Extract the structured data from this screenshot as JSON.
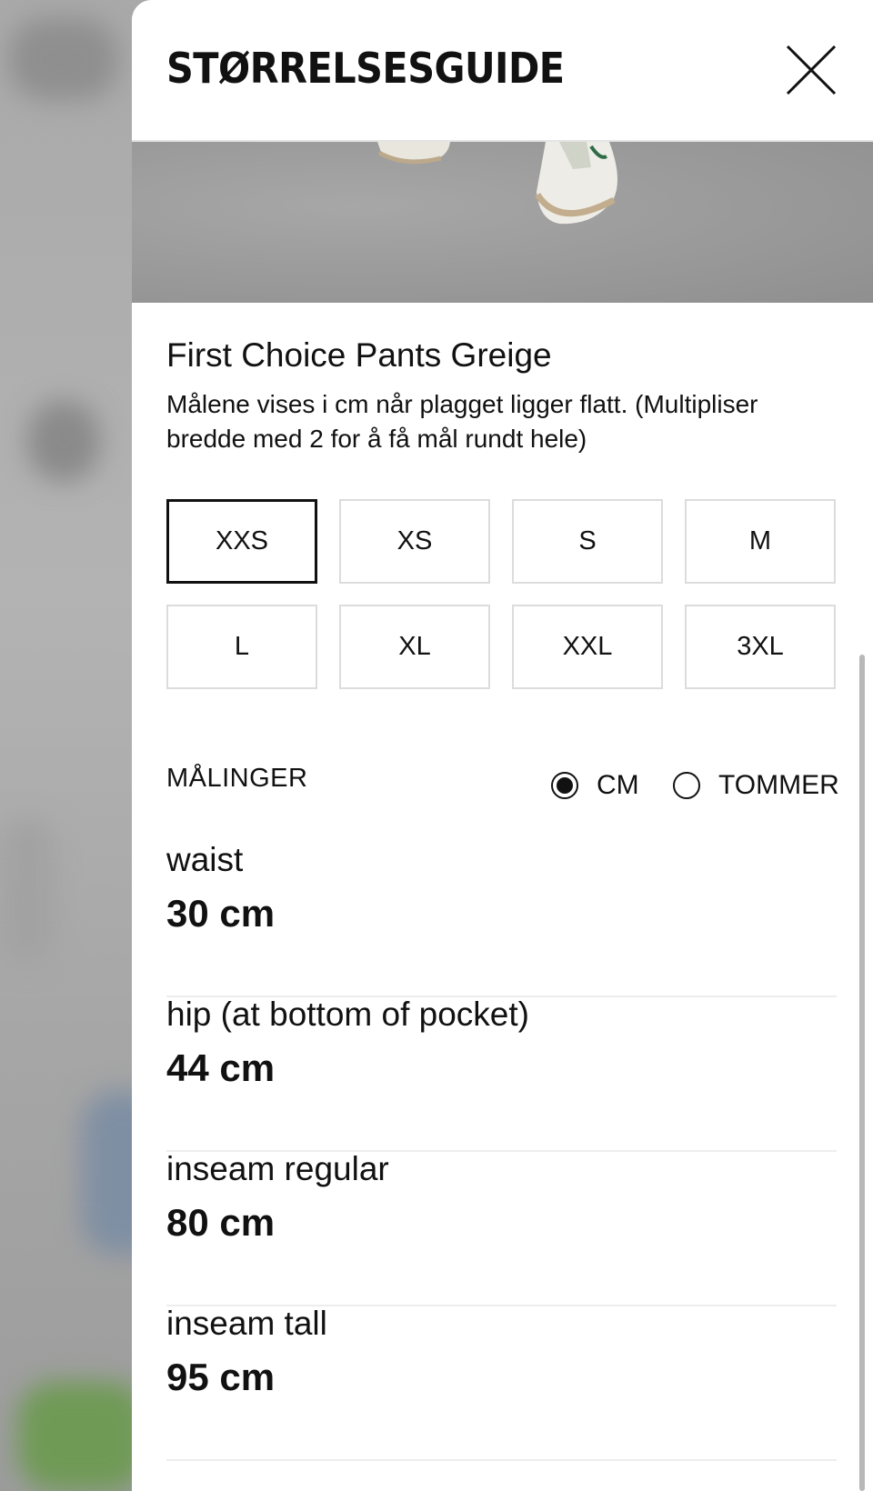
{
  "header": {
    "title": "STØRRELSESGUIDE"
  },
  "product": {
    "name": "First Choice Pants Greige",
    "description": "Målene vises i cm når plagget ligger flatt. (Multipliser bredde med 2 for å få mål rundt hele)"
  },
  "sizes": [
    "XXS",
    "XS",
    "S",
    "M",
    "L",
    "XL",
    "XXL",
    "3XL"
  ],
  "selected_size": "XXS",
  "measurements": {
    "heading": "MÅLINGER",
    "units": [
      {
        "label": "CM",
        "selected": true
      },
      {
        "label": "TOMMER",
        "selected": false
      }
    ],
    "rows": [
      {
        "label": "waist",
        "value": "30 cm"
      },
      {
        "label": "hip (at bottom of pocket)",
        "value": "44 cm"
      },
      {
        "label": "inseam regular",
        "value": "80 cm"
      },
      {
        "label": "inseam tall",
        "value": "95 cm"
      }
    ]
  }
}
